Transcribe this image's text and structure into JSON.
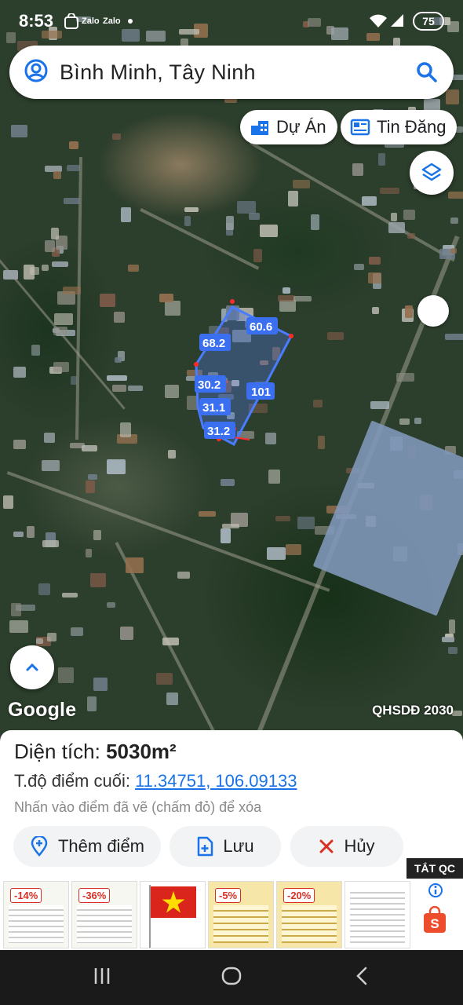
{
  "status_bar": {
    "time": "8:53",
    "notification_icons": [
      "shopee-icon",
      "zalo-icon",
      "zalo-icon",
      "dot-icon"
    ],
    "zalo_label": "Zalo",
    "battery": "75"
  },
  "search": {
    "query": "Bình Minh, Tây Ninh"
  },
  "chips": {
    "du_an": "Dự Án",
    "tin_dang": "Tin Đăng"
  },
  "map": {
    "logo": "Google",
    "overlay_label": "QHSDĐ 2030",
    "polygon_edges": [
      "60.6",
      "68.2",
      "30.2",
      "31.1",
      "31.2",
      "101"
    ]
  },
  "sheet": {
    "area_label": "Diện tích: ",
    "area_value": "5030m²",
    "coord_label": "T.độ điểm cuối: ",
    "coord_value": "11.34751, 106.09133",
    "hint": "Nhấn vào điểm đã vẽ (chấm đỏ) để xóa",
    "buttons": {
      "add_point": "Thêm điểm",
      "save": "Lưu",
      "cancel": "Hủy"
    }
  },
  "ads": {
    "close_label": "TẮT QC",
    "discounts": [
      "-14%",
      "-36%",
      "-5%",
      "-20%"
    ]
  },
  "colors": {
    "accent": "#1a73e8",
    "polygon": "#4a7cff",
    "cancel": "#d93025",
    "map_dark": "#2c3e2c"
  }
}
